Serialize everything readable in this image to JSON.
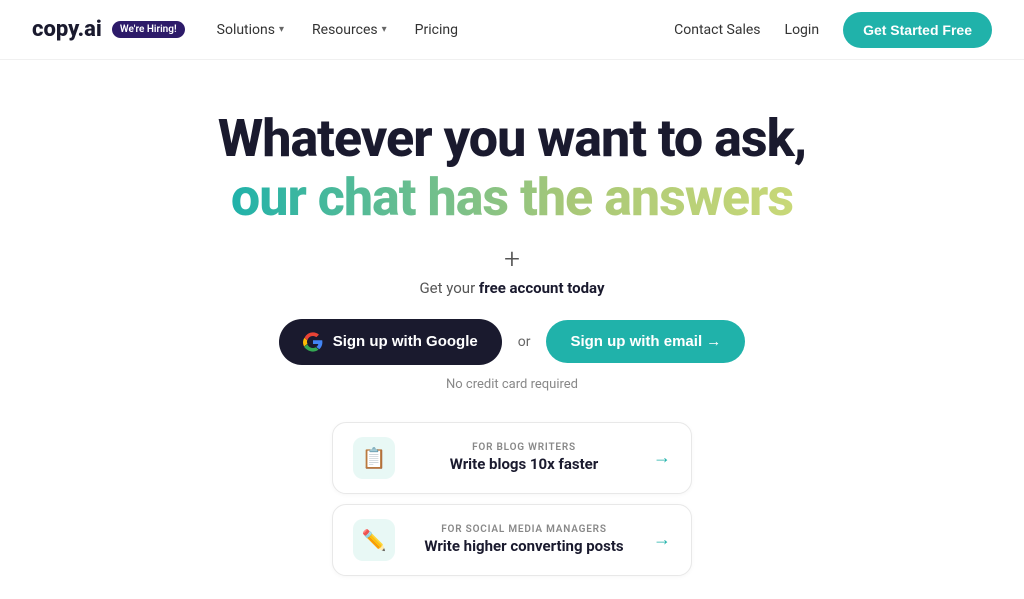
{
  "nav": {
    "logo": "copy.ai",
    "hiring_badge": "We're Hiring!",
    "links": [
      {
        "label": "Solutions",
        "has_dropdown": true
      },
      {
        "label": "Resources",
        "has_dropdown": true
      },
      {
        "label": "Pricing",
        "has_dropdown": false
      }
    ],
    "right": {
      "contact": "Contact Sales",
      "login": "Login",
      "cta": "Get Started Free"
    }
  },
  "hero": {
    "title_line1": "Whatever you want to ask,",
    "title_line2": "our chat has the answers",
    "plus_symbol": "+",
    "subtext_pre": "Get your ",
    "subtext_bold": "free account today",
    "btn_google": "Sign up with Google",
    "or": "or",
    "btn_email": "Sign up with email →",
    "no_cc": "No credit card required"
  },
  "features": [
    {
      "label": "FOR BLOG WRITERS",
      "title": "Write blogs 10x faster",
      "icon": "📄"
    },
    {
      "label": "FOR SOCIAL MEDIA MANAGERS",
      "title": "Write higher converting posts",
      "icon": "🖊"
    }
  ]
}
